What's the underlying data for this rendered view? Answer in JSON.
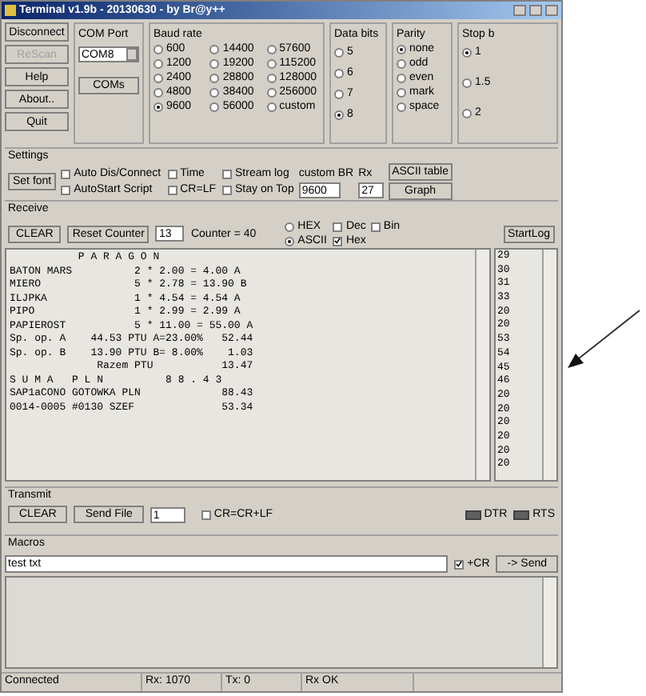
{
  "window": {
    "title": "Terminal v1.9b - 20130630 - by Br@y++"
  },
  "connection_buttons": [
    {
      "label": "Disconnect",
      "disabled": false
    },
    {
      "label": "ReScan",
      "disabled": true
    },
    {
      "label": "Help",
      "disabled": false
    },
    {
      "label": "About..",
      "disabled": false
    },
    {
      "label": "Quit",
      "disabled": false
    }
  ],
  "com_port": {
    "title": "COM Port",
    "value": "COM8",
    "button": "COMs"
  },
  "baud_rate": {
    "title": "Baud rate",
    "options": [
      {
        "label": "600",
        "selected": false
      },
      {
        "label": "1200",
        "selected": false
      },
      {
        "label": "2400",
        "selected": false
      },
      {
        "label": "4800",
        "selected": false
      },
      {
        "label": "9600",
        "selected": true
      },
      {
        "label": "14400",
        "selected": false
      },
      {
        "label": "19200",
        "selected": false
      },
      {
        "label": "28800",
        "selected": false
      },
      {
        "label": "38400",
        "selected": false
      },
      {
        "label": "56000",
        "selected": false
      },
      {
        "label": "57600",
        "selected": false
      },
      {
        "label": "115200",
        "selected": false
      },
      {
        "label": "128000",
        "selected": false
      },
      {
        "label": "256000",
        "selected": false
      },
      {
        "label": "custom",
        "selected": false
      }
    ]
  },
  "data_bits": {
    "title": "Data bits",
    "options": [
      {
        "label": "5",
        "selected": false
      },
      {
        "label": "6",
        "selected": false
      },
      {
        "label": "7",
        "selected": false
      },
      {
        "label": "8",
        "selected": true
      }
    ]
  },
  "parity": {
    "title": "Parity",
    "options": [
      {
        "label": "none",
        "selected": true
      },
      {
        "label": "odd",
        "selected": false
      },
      {
        "label": "even",
        "selected": false
      },
      {
        "label": "mark",
        "selected": false
      },
      {
        "label": "space",
        "selected": false
      }
    ]
  },
  "stop_bits": {
    "title": "Stop b",
    "options": [
      {
        "label": "1",
        "selected": true
      },
      {
        "label": "1.5",
        "selected": false
      },
      {
        "label": "2",
        "selected": false
      }
    ]
  },
  "settings": {
    "title": "Settings",
    "button": "Set font",
    "checkboxes": [
      {
        "label": "Auto Dis/Connect",
        "checked": false
      },
      {
        "label": "AutoStart Script",
        "checked": false
      },
      {
        "label": "Time",
        "checked": false
      },
      {
        "label": "CR=LF",
        "checked": false
      },
      {
        "label": "Stream log",
        "checked": false
      },
      {
        "label": "Stay on Top",
        "checked": false
      }
    ],
    "custom_br_label": "custom BR",
    "custom_br": "9600",
    "rx_label": "Rx",
    "rx_value": "27",
    "ascii_button": "ASCII table",
    "graph_button": "Graph"
  },
  "receive": {
    "title": "Receive",
    "clear_button": "CLEAR",
    "reset_button": "Reset Counter",
    "counter_value": "13",
    "counter": "Counter = 40",
    "modes": [
      {
        "label": "HEX",
        "selected": false
      },
      {
        "label": "ASCII",
        "selected": true
      }
    ],
    "formats": [
      {
        "label": "Dec",
        "checked": false
      },
      {
        "label": "Hex",
        "checked": true
      },
      {
        "label": "Bin",
        "checked": false
      }
    ],
    "log_button": "StartLog"
  },
  "terminal_lines": [
    "           P A R A G O N",
    "BATON MARS          2 * 2.00 = 4.00 A",
    "MIERO               5 * 2.78 = 13.90 B",
    "ILJPKA              1 * 4.54 = 4.54 A",
    "PIPO                1 * 2.99 = 2.99 A",
    "PAPIEROST           5 * 11.00 = 55.00 A",
    "Sp. op. A    44.53 PTU A=23.00%   52.44",
    "Sp. op. B    13.90 PTU B= 8.00%    1.03",
    "              Razem PTU           13.47",
    "S U M A   P L N          8 8 . 4 3",
    "SAP1aCONO GOTOWKA PLN             88.43",
    "0014-0005 #0130 SZEF              53.34"
  ],
  "hex_values": [
    "29",
    "30",
    "31",
    "33",
    "20",
    "20",
    "53",
    "54",
    "45",
    "46",
    "20",
    "20",
    "20",
    "20",
    "20",
    "20"
  ],
  "transmit": {
    "title": "Transmit",
    "clear_button": "CLEAR",
    "send_file_button": "Send File",
    "repeat": "1",
    "cr_checkbox": {
      "label": "CR=CR+LF",
      "checked": false
    },
    "lines": [
      {
        "label": "DTR",
        "on": false
      },
      {
        "label": "RTS",
        "on": false
      }
    ]
  },
  "macros": {
    "title": "Macros",
    "input": "test txt",
    "cr_checkbox": {
      "label": "+CR",
      "checked": true
    },
    "send_button": "-> Send"
  },
  "status_bar": [
    "Connected",
    "Rx: 1070",
    "Tx: 0",
    "Rx OK"
  ]
}
